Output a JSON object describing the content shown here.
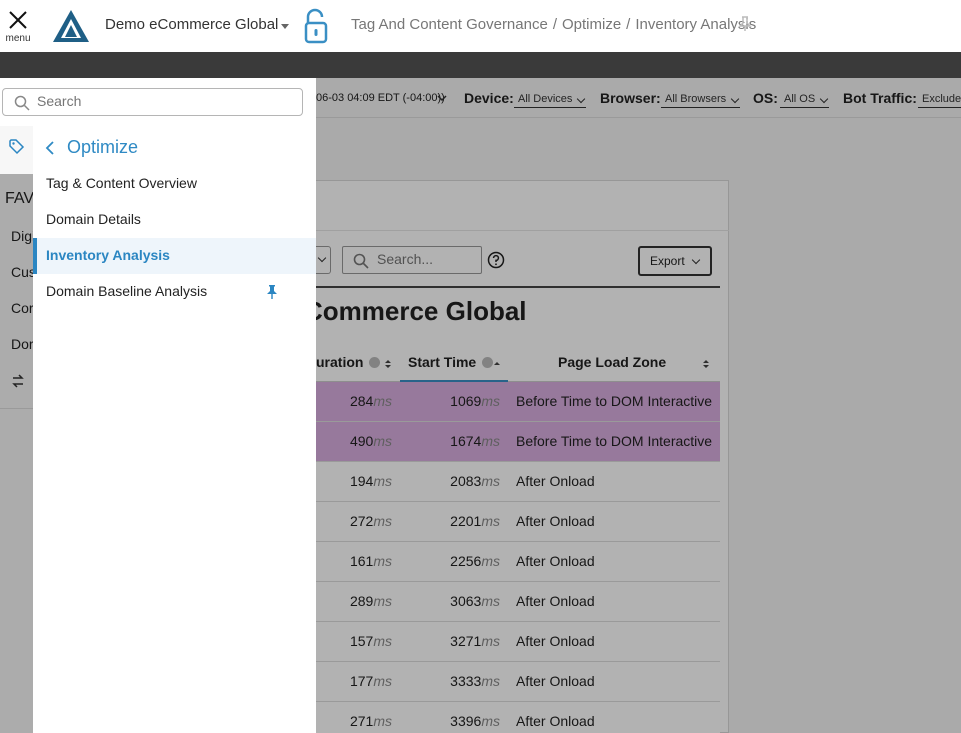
{
  "header": {
    "menu_label": "menu",
    "org_name": "Demo eCommerce Global",
    "breadcrumb": [
      "Tag And Content Governance",
      "Optimize",
      "Inventory Analysis"
    ]
  },
  "filters": {
    "date_range": "06-03 04:09 EDT (-04:00))",
    "device_label": "Device:",
    "device_value": "All Devices",
    "browser_label": "Browser:",
    "browser_value": "All Browsers",
    "os_label": "OS:",
    "os_value": "All OS",
    "bot_label": "Bot Traffic:",
    "bot_value": "Exclude"
  },
  "rail": {
    "fav": "FAV",
    "items": [
      "Digi",
      "Cus",
      "Cor",
      "Dor"
    ]
  },
  "toolbar": {
    "search_placeholder": "Search...",
    "export_label": "Export"
  },
  "table": {
    "title": "Commerce Global",
    "columns": [
      "uration",
      "Start Time",
      "Page Load Zone"
    ],
    "unit": "ms",
    "rows": [
      {
        "duration": "284",
        "start": "1069",
        "zone": "Before Time to DOM Interactive",
        "highlight": true
      },
      {
        "duration": "490",
        "start": "1674",
        "zone": "Before Time to DOM Interactive",
        "highlight": true
      },
      {
        "duration": "194",
        "start": "2083",
        "zone": "After Onload",
        "highlight": false
      },
      {
        "duration": "272",
        "start": "2201",
        "zone": "After Onload",
        "highlight": false
      },
      {
        "duration": "161",
        "start": "2256",
        "zone": "After Onload",
        "highlight": false
      },
      {
        "duration": "289",
        "start": "3063",
        "zone": "After Onload",
        "highlight": false
      },
      {
        "duration": "157",
        "start": "3271",
        "zone": "After Onload",
        "highlight": false
      },
      {
        "duration": "177",
        "start": "3333",
        "zone": "After Onload",
        "highlight": false
      },
      {
        "duration": "271",
        "start": "3396",
        "zone": "After Onload",
        "highlight": false
      }
    ]
  },
  "drawer": {
    "search_placeholder": "Search",
    "back_label": "Optimize",
    "items": [
      {
        "label": "Tag & Content Overview",
        "active": false,
        "pinned": false
      },
      {
        "label": "Domain Details",
        "active": false,
        "pinned": false
      },
      {
        "label": "Inventory Analysis",
        "active": true,
        "pinned": false
      },
      {
        "label": "Domain Baseline Analysis",
        "active": false,
        "pinned": true
      }
    ]
  },
  "colors": {
    "accent": "#2b86c2",
    "highlight_row": "#d9aee0",
    "dark_bar": "#3a3a3a",
    "logo": "#1f5f86"
  },
  "icons": [
    "close-icon",
    "logo-icon",
    "lock-icon",
    "pin-icon",
    "search-icon",
    "chevron-left-icon",
    "tag-icon",
    "swap-icon",
    "help-icon"
  ]
}
